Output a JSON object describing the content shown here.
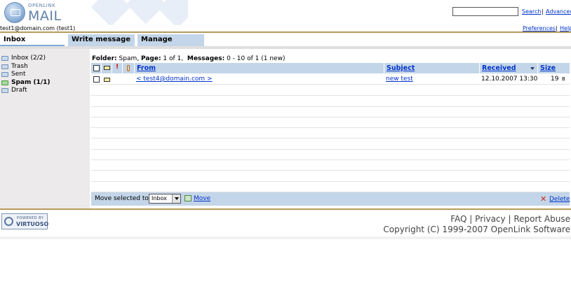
{
  "header": {
    "logo_top": "OPENLINK",
    "logo_main": "MAIL",
    "search_label": "Search",
    "separator": "|",
    "advanced_label": "Advanced",
    "user": "test1@domain.com (test1)",
    "preferences_label": "Preferences",
    "help_label": "Help"
  },
  "tabs": [
    {
      "label": "Inbox",
      "active": true
    },
    {
      "label": "Write message",
      "active": false
    },
    {
      "label": "Manage",
      "active": false
    }
  ],
  "sidebar": {
    "folders": [
      {
        "label": "Inbox (2/2)",
        "active": false
      },
      {
        "label": "Trash",
        "active": false
      },
      {
        "label": "Sent",
        "active": false
      },
      {
        "label": "Spam (1/1)",
        "active": true
      },
      {
        "label": "Draft",
        "active": false
      }
    ]
  },
  "folder_info": {
    "folder_label": "Folder:",
    "folder_value": "Spam,",
    "page_label": "Page:",
    "page_value": "1 of 1,",
    "messages_label": "Messages:",
    "messages_value": "0 - 10 of 1 (1 new)"
  },
  "grid": {
    "columns": {
      "from": "From",
      "subject": "Subject",
      "received": "Received",
      "size": "Size"
    },
    "rows": [
      {
        "from": "< test4@domain.com >",
        "subject": "new test",
        "received": "12.10.2007 13:30",
        "size": "19",
        "size_unit": "B"
      }
    ]
  },
  "actions": {
    "move_label": "Move selected to",
    "move_target": "Inbox",
    "move_button": "Move",
    "delete_button": "Delete"
  },
  "footer": {
    "badge_top": "POWERED BY",
    "badge_main": "VIRTUOSO",
    "faq": "FAQ",
    "privacy": "Privacy",
    "abuse": "Report Abuse",
    "sep": "|",
    "copyright": "Copyright (C) 1999-2007 OpenLink Software"
  },
  "colors": {
    "accent": "#c3d5e8",
    "link": "#0033cc",
    "rule": "#b89a5a",
    "sidebar": "#eceaea"
  }
}
